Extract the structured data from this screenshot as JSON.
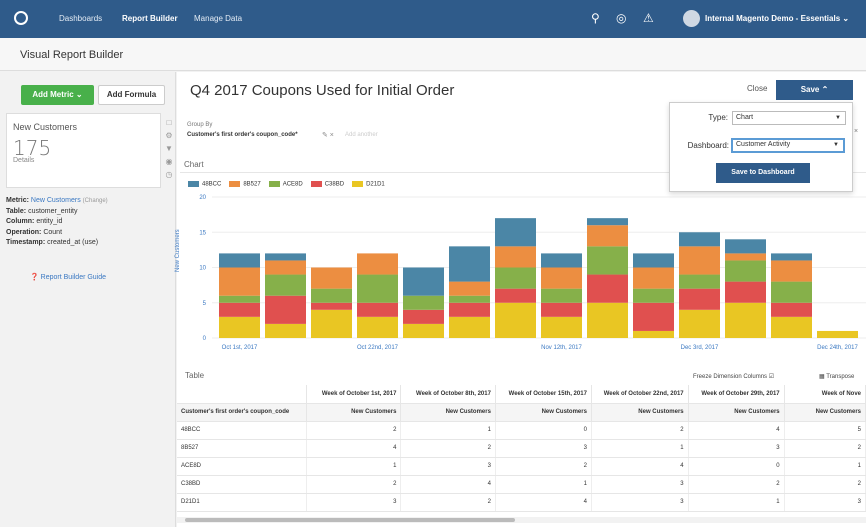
{
  "topbar": {
    "nav": [
      "Dashboards",
      "Report Builder",
      "Manage Data"
    ],
    "account": "Internal Magento Demo - Essentials",
    "icons": [
      "search-icon",
      "globe-icon",
      "bell-icon"
    ]
  },
  "page_title": "Visual Report Builder",
  "left": {
    "add_metric": "Add Metric",
    "add_formula": "Add Formula",
    "metric_name": "New Customers",
    "metric_count": "175",
    "details": "Details",
    "metric_label": "Metric:",
    "metric_value": "New Customers",
    "change": "(Change)",
    "table_label": "Table:",
    "table_value": "customer_entity",
    "column_label": "Column:",
    "column_value": "entity_id",
    "operation_label": "Operation:",
    "operation_value": "Count",
    "timestamp_label": "Timestamp:",
    "timestamp_value": "created_at (use)",
    "guide": "Report Builder Guide"
  },
  "report": {
    "title": "Q4 2017 Coupons Used for Initial Order",
    "close": "Close",
    "save": "Save",
    "group_by_label": "Group By",
    "group_by_value": "Customer's first order's coupon_code*",
    "group_by_add": "Add another"
  },
  "popup": {
    "type_label": "Type:",
    "type_value": "Chart",
    "dashboard_label": "Dashboard:",
    "dashboard_value": "Customer Activity",
    "save_to_dashboard": "Save to Dashboard"
  },
  "chart_section_label": "Chart",
  "chart_data": {
    "type": "bar",
    "stacked": true,
    "ylabel": "New Customers",
    "ylim": [
      0,
      20
    ],
    "yticks": [
      "0",
      "5",
      "10",
      "15",
      "20"
    ],
    "xtick_labels": [
      "Oct 1st, 2017",
      "Oct 22nd, 2017",
      "Nov 12th, 2017",
      "Dec 3rd, 2017",
      "Dec 24th, 2017"
    ],
    "xtick_indices": [
      0,
      3,
      7,
      10,
      13
    ],
    "series": [
      {
        "name": "D21D1",
        "color": "#e9c623",
        "values": [
          3,
          2,
          4,
          3,
          2,
          3,
          5,
          3,
          5,
          1,
          4,
          5,
          3,
          1
        ]
      },
      {
        "name": "C38BD",
        "color": "#e0504f",
        "values": [
          2,
          4,
          1,
          2,
          2,
          2,
          2,
          2,
          4,
          4,
          3,
          3,
          2,
          0
        ]
      },
      {
        "name": "ACE8D",
        "color": "#86b04a",
        "values": [
          1,
          3,
          2,
          4,
          2,
          1,
          3,
          2,
          4,
          2,
          2,
          3,
          3,
          0
        ]
      },
      {
        "name": "8B527",
        "color": "#ec8e41",
        "values": [
          4,
          2,
          3,
          3,
          0,
          2,
          3,
          3,
          3,
          3,
          4,
          1,
          3,
          0
        ]
      },
      {
        "name": "48BCC",
        "color": "#4b86a6",
        "values": [
          2,
          1,
          0,
          0,
          4,
          5,
          4,
          2,
          1,
          2,
          2,
          2,
          1,
          0
        ]
      }
    ]
  },
  "table": {
    "label": "Table",
    "freeze": "Freeze Dimension Columns",
    "transpose": "Transpose",
    "weeks": [
      "Week of October 1st, 2017",
      "Week of October 8th, 2017",
      "Week of October 15th, 2017",
      "Week of October 22nd, 2017",
      "Week of October 29th, 2017",
      "Week of Nove"
    ],
    "dimension_header": "Customer's first order's coupon_code",
    "metric_header": "New Customers",
    "rows": [
      {
        "code": "48BCC",
        "values": [
          "2",
          "1",
          "0",
          "2",
          "4",
          "5"
        ]
      },
      {
        "code": "8B527",
        "values": [
          "4",
          "2",
          "3",
          "1",
          "3",
          "2"
        ]
      },
      {
        "code": "ACE8D",
        "values": [
          "1",
          "3",
          "2",
          "4",
          "0",
          "1"
        ]
      },
      {
        "code": "C38BD",
        "values": [
          "2",
          "4",
          "1",
          "3",
          "2",
          "2"
        ]
      },
      {
        "code": "D21D1",
        "values": [
          "3",
          "2",
          "4",
          "3",
          "1",
          "3"
        ]
      }
    ]
  }
}
